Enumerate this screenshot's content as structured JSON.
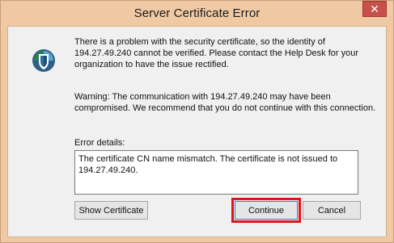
{
  "window": {
    "title": "Server Certificate Error",
    "close_glyph": "✕"
  },
  "icon": "security-shield-icon",
  "message": "There is a problem with the security certificate, so the identity of 194.27.49.240 cannot be verified. Please contact the Help Desk for your organization to have the issue rectified.",
  "warning": "Warning: The communication with 194.27.49.240 may have been compromised. We recommend that you do not continue with this connection.",
  "error_details": {
    "label": "Error details:",
    "text": "The certificate CN name mismatch. The certificate is not issued to 194.27.49.240."
  },
  "buttons": {
    "show_certificate": "Show Certificate",
    "continue": "Continue",
    "cancel": "Cancel"
  },
  "colors": {
    "frame": "#efc9a3",
    "close_button": "#c7504a",
    "highlight": "#e0141e"
  }
}
